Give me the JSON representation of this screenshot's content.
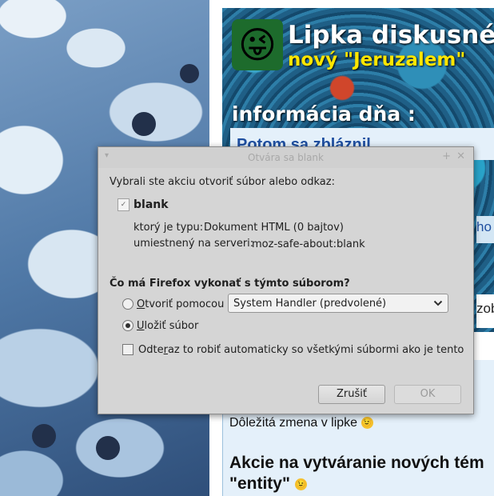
{
  "website": {
    "site_title": "Lipka diskusné f",
    "site_subtitle": "nový \"Jeruzalem\"",
    "logo_emoji": "😜",
    "info_heading": "informácia dňa :",
    "info_link": "Potom sa zbláznil",
    "side_fragment_1": "ho a",
    "side_fragment_2": "zob",
    "news_1": "Dôležitá zmena v lipke",
    "news_2_line1": "Akcie na vytváranie nových tém",
    "news_2_line2": "\"entity\"",
    "wink_glyph": "😉"
  },
  "dialog": {
    "title": "Otvára sa blank",
    "intro": "Vybrali ste akciu otvoriť súbor alebo odkaz:",
    "file_name": "blank",
    "file_icon": "✓",
    "type_label": "ktorý je typu:",
    "type_value": "Dokument HTML (0 bajtov)",
    "server_label": "umiestnený na serveri:",
    "server_value": "moz-safe-about:blank",
    "question": "Čo má Firefox vykonať s týmto súborom?",
    "open_with_label_access": "O",
    "open_with_label_rest": "tvoriť pomocou",
    "handler_value": "System Handler (predvolené)",
    "save_label_access": "U",
    "save_label_rest": "ložiť súbor",
    "selected_option": "save",
    "auto_label_pre": "Odte",
    "auto_label_access": "r",
    "auto_label_post": "az to robiť automaticky so všetkými súbormi ako je tento",
    "auto_checked": false,
    "cancel_label": "Zrušiť",
    "ok_label": "OK",
    "ok_enabled": false
  },
  "titlebar_icons": {
    "menu": "▾",
    "pin": "+",
    "close": "✕"
  }
}
